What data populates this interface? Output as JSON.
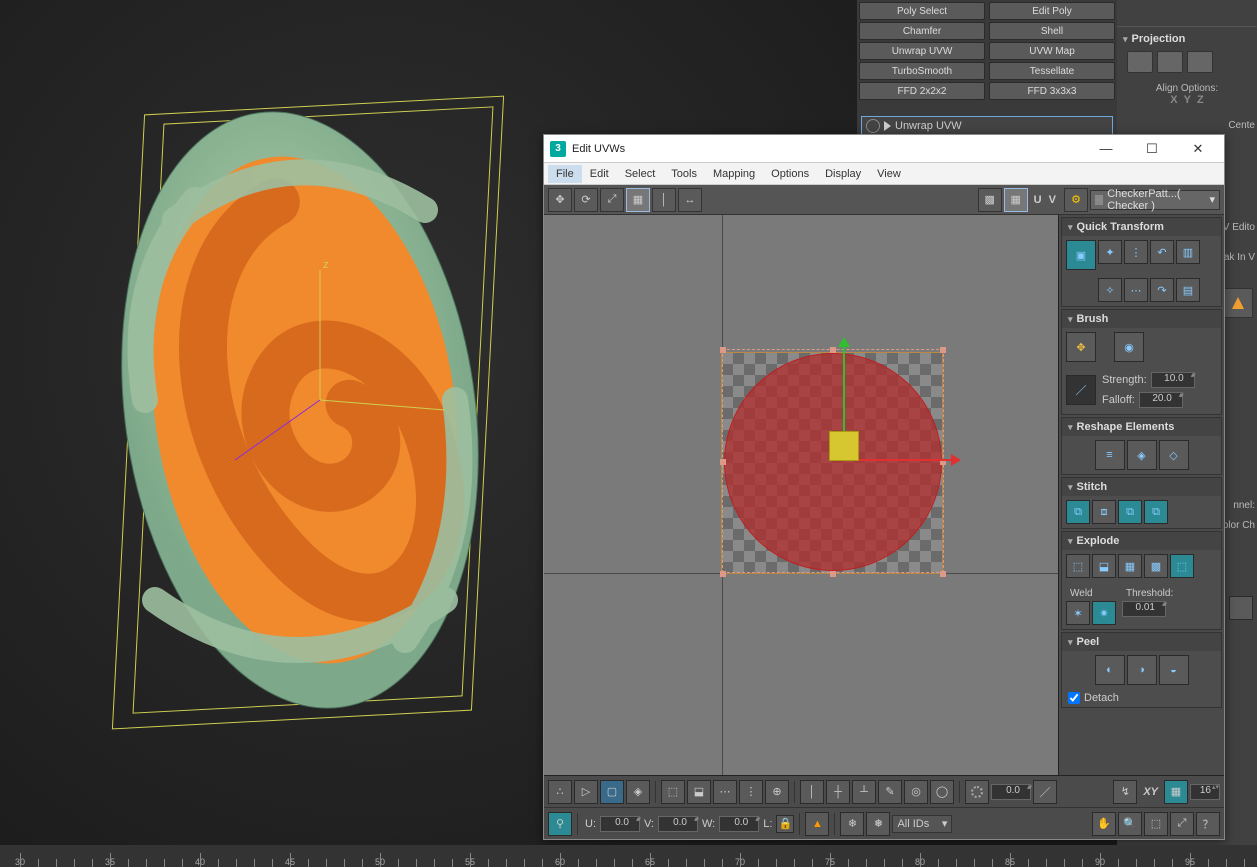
{
  "modifier_buttons": [
    [
      "Poly Select",
      "Edit Poly"
    ],
    [
      "Chamfer",
      "Shell"
    ],
    [
      "Unwrap UVW",
      "UVW Map"
    ],
    [
      "TurboSmooth",
      "Tessellate"
    ],
    [
      "FFD 2x2x2",
      "FFD 3x3x3"
    ]
  ],
  "stack_current": "Unwrap UVW",
  "right_panel": {
    "projection_title": "Projection",
    "align_label": "Align Options:",
    "xyz": [
      "X",
      "Y",
      "Z"
    ],
    "edge_labels": {
      "editor": "V Edito",
      "tweak": "ak In V",
      "channel": "nnel:",
      "colorch": "olor Ch",
      "center": "Cente"
    }
  },
  "uv_window": {
    "title": "Edit UVWs",
    "menus": [
      "File",
      "Edit",
      "Select",
      "Tools",
      "Mapping",
      "Options",
      "Display",
      "View"
    ],
    "active_menu": "File",
    "uv_label": "U V",
    "texture_dropdown": "CheckerPatt...( Checker )",
    "rollouts": {
      "quick_transform": "Quick Transform",
      "brush": "Brush",
      "brush_strength_label": "Strength:",
      "brush_strength": "10.0",
      "brush_falloff_label": "Falloff:",
      "brush_falloff": "20.0",
      "reshape": "Reshape Elements",
      "stitch": "Stitch",
      "explode": "Explode",
      "weld_label": "Weld",
      "threshold_label": "Threshold:",
      "threshold": "0.01",
      "peel": "Peel",
      "detach_label": "Detach"
    },
    "bottom": {
      "u_label": "U:",
      "u": "0.0",
      "v_label": "V:",
      "v": "0.0",
      "w_label": "W:",
      "w": "0.0",
      "l_label": "L:",
      "spin0": "0.0",
      "xy": "XY",
      "grid": "16",
      "ids": "All IDs"
    }
  },
  "ruler_ticks": [
    30,
    35,
    40,
    45,
    50,
    55,
    60,
    65,
    70,
    75,
    80,
    85,
    90,
    95
  ]
}
